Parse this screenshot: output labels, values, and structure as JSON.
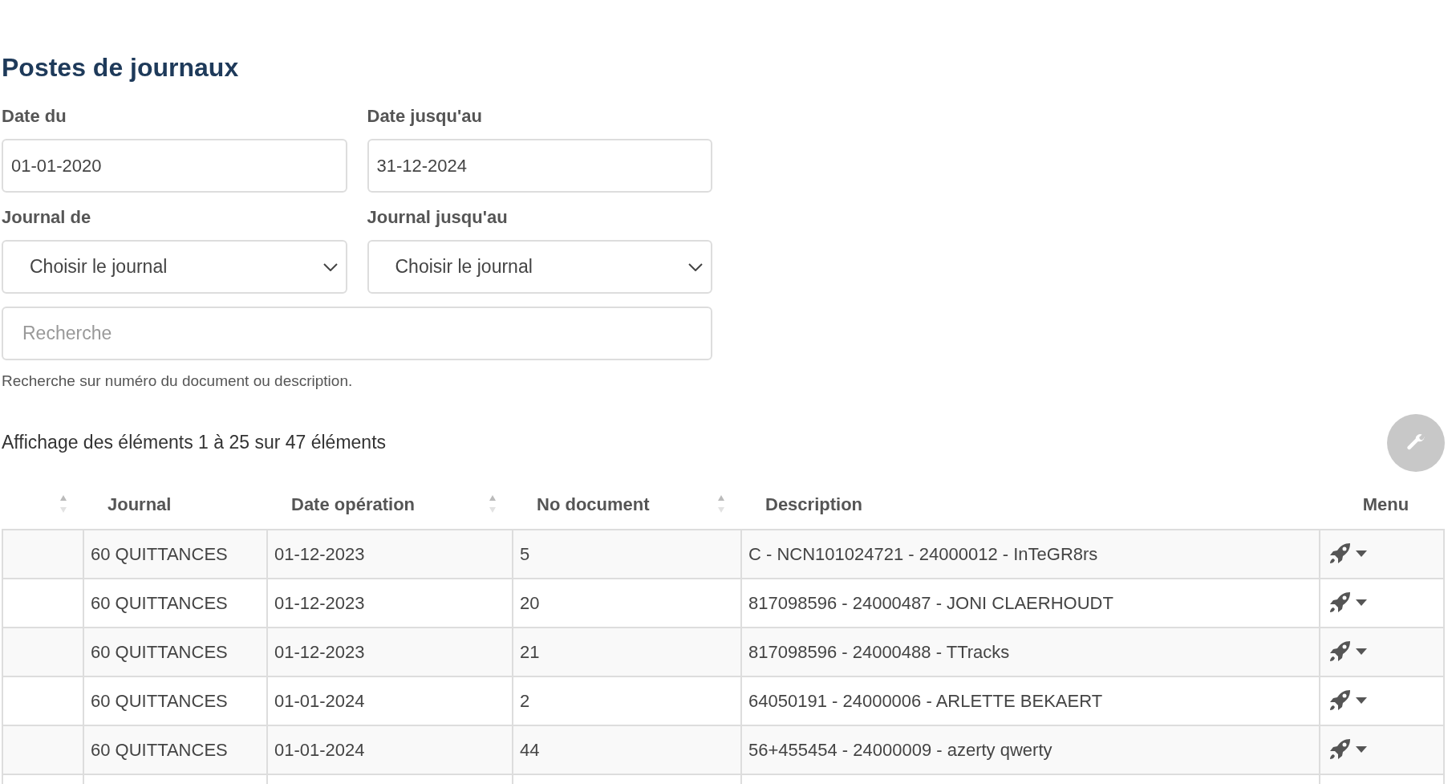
{
  "title": "Postes de journaux",
  "filters": {
    "date_from": {
      "label": "Date du",
      "value": "01-01-2020"
    },
    "date_to": {
      "label": "Date jusqu'au",
      "value": "31-12-2024"
    },
    "journal_from": {
      "label": "Journal de",
      "value": "Choisir le journal"
    },
    "journal_to": {
      "label": "Journal jusqu'au",
      "value": "Choisir le journal"
    }
  },
  "search": {
    "placeholder": "Recherche",
    "help": "Recherche sur numéro du document ou description."
  },
  "summary": "Affichage des éléments 1 à 25 sur 47 éléments",
  "table": {
    "columns": [
      {
        "sortable": true
      },
      {
        "label": "Journal",
        "sortable": false
      },
      {
        "label": "Date opération",
        "sortable": true
      },
      {
        "label": "No document",
        "sortable": true
      },
      {
        "label": "Description",
        "sortable": false
      },
      {
        "label": "Menu",
        "sortable": false
      }
    ],
    "rows": [
      {
        "journal": "60 QUITTANCES",
        "date": "01-12-2023",
        "document": "5",
        "description": "C - NCN101024721 - 24000012 - InTeGR8rs"
      },
      {
        "journal": "60 QUITTANCES",
        "date": "01-12-2023",
        "document": "20",
        "description": "817098596 - 24000487 - JONI CLAERHOUDT"
      },
      {
        "journal": "60 QUITTANCES",
        "date": "01-12-2023",
        "document": "21",
        "description": "817098596 - 24000488 - TTracks"
      },
      {
        "journal": "60 QUITTANCES",
        "date": "01-01-2024",
        "document": "2",
        "description": "64050191 - 24000006 - ARLETTE BEKAERT"
      },
      {
        "journal": "60 QUITTANCES",
        "date": "01-01-2024",
        "document": "44",
        "description": "56+455454 - 24000009 - azerty qwerty"
      }
    ]
  }
}
